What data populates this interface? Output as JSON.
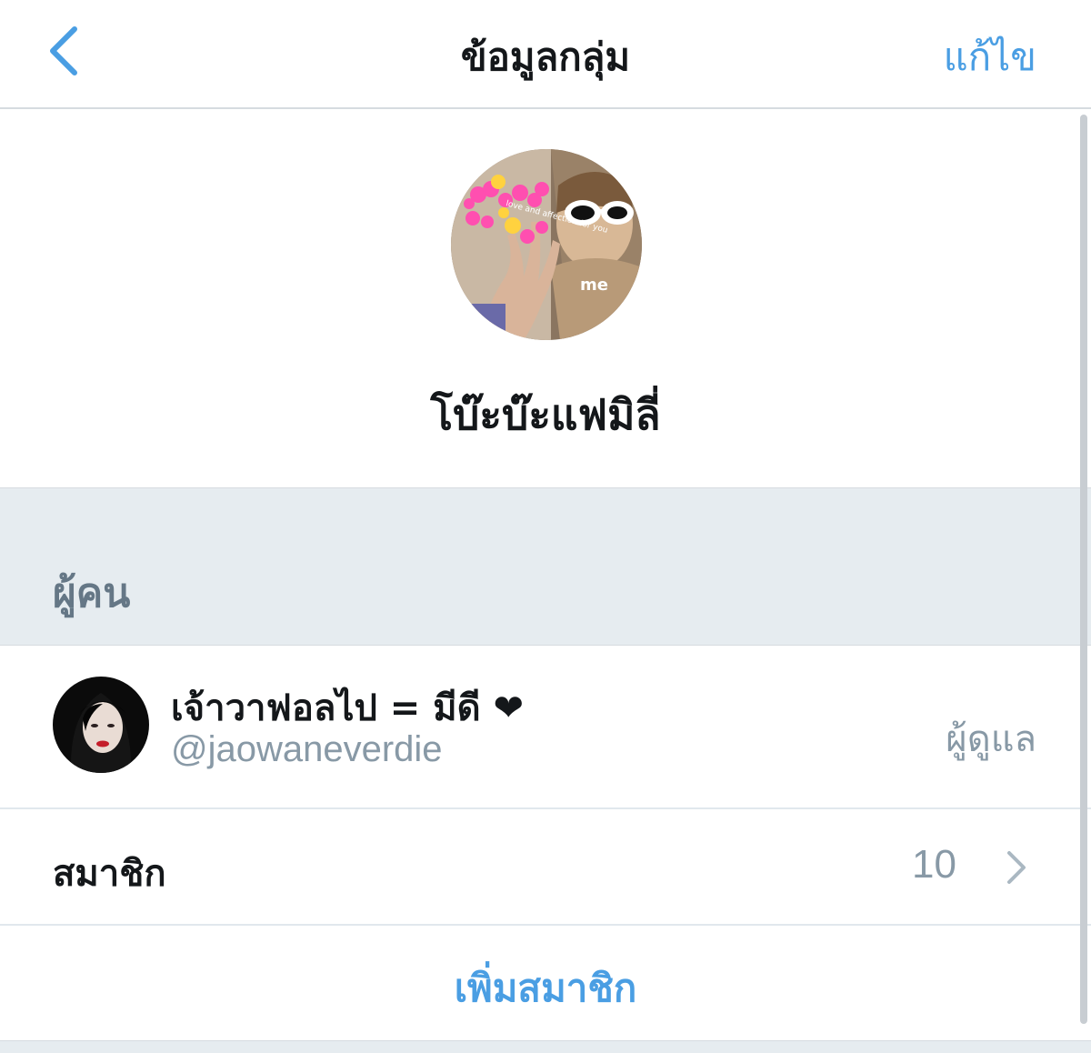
{
  "nav": {
    "title": "ข้อมูลกลุ่ม",
    "edit_label": "แก้ไข"
  },
  "group": {
    "name": "โบ๊ะบ๊ะแฟมิลี่",
    "avatar_text": "me",
    "avatar_sticker_text": "love and affection for you"
  },
  "people_section": {
    "label": "ผู้คน"
  },
  "member": {
    "display_name": "เจ้าวาฟอลไป = มีดี ❤",
    "handle": "@jaowaneverdie",
    "role": "ผู้ดูแล"
  },
  "members_row": {
    "label": "สมาชิก",
    "count": "10"
  },
  "add_members": {
    "label": "เพิ่มสมาชิก"
  },
  "colors": {
    "accent": "#4a9ee3",
    "secondary_text": "#8899a6",
    "section_bg": "#e6ecf0"
  }
}
